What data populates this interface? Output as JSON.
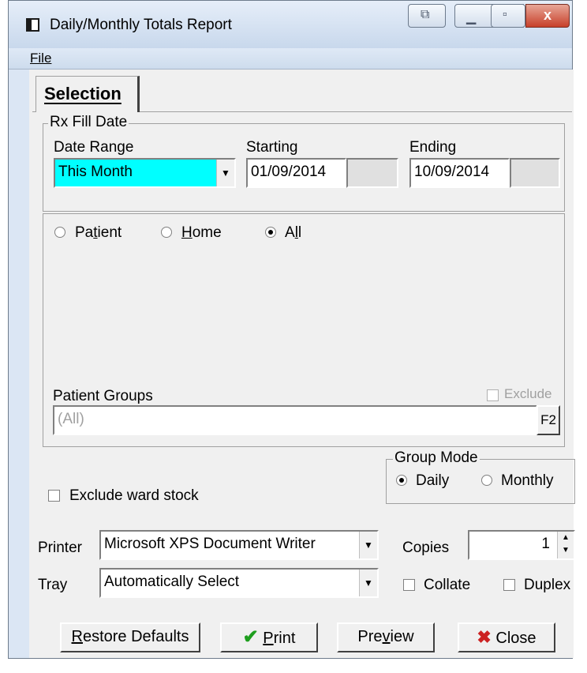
{
  "window": {
    "title": "Daily/Monthly Totals Report",
    "close_glyph": "x"
  },
  "menu": {
    "file": "File"
  },
  "tab": {
    "label": "Selection"
  },
  "fill_date": {
    "legend": "Rx Fill Date",
    "date_range_label": "Date Range",
    "date_range_value": "This Month",
    "starting_label": "Starting",
    "starting_value": "01/09/2014",
    "ending_label": "Ending",
    "ending_value": "10/09/2014"
  },
  "filter": {
    "patient": "Patient",
    "home": "Home",
    "all": "All",
    "selected": "All",
    "patient_groups_label": "Patient Groups",
    "exclude_label": "Exclude",
    "patient_groups_value": "(All)",
    "f2_button": "F2"
  },
  "group_mode": {
    "legend": "Group Mode",
    "daily": "Daily",
    "monthly": "Monthly",
    "selected": "Daily"
  },
  "exclude_ward_stock": "Exclude ward stock",
  "printer": {
    "label": "Printer",
    "value": "Microsoft XPS Document Writer"
  },
  "tray": {
    "label": "Tray",
    "value": "Automatically Select"
  },
  "copies": {
    "label": "Copies",
    "value": "1"
  },
  "collate": "Collate",
  "duplex": "Duplex",
  "buttons": {
    "restore": "Restore Defaults",
    "print": "Print",
    "preview": "Preview",
    "close": "Close"
  },
  "colors": {
    "highlight": "#00ffff",
    "check_green": "#1e9e1e",
    "close_red": "#cc2222"
  }
}
